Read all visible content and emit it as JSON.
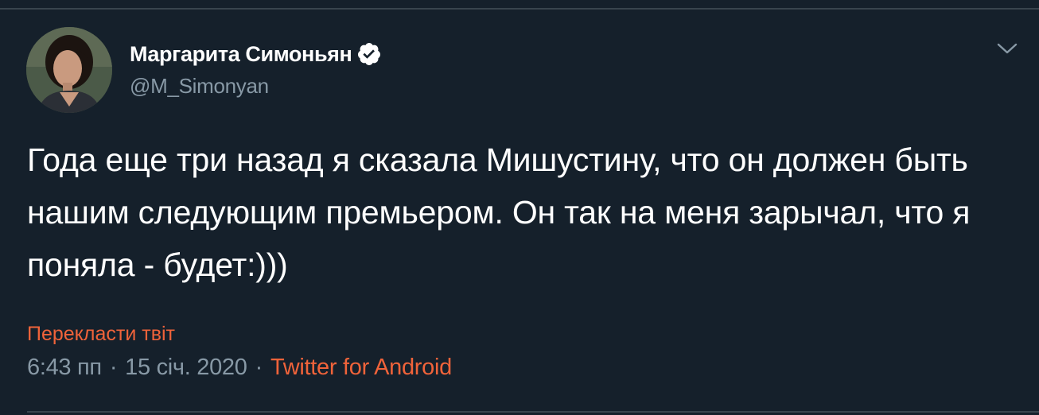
{
  "tweet": {
    "author": {
      "display_name": "Маргарита Симоньян",
      "handle": "@M_Simonyan",
      "verified": true
    },
    "text": "Года еще три назад я сказала Мишустину, что он должен быть нашим следующим премьером. Он так на меня зарычал, что я поняла - будет:)))",
    "translate_label": "Перекласти твіт",
    "time": "6:43 пп",
    "separator": "·",
    "date": "15 січ. 2020",
    "source": "Twitter for Android"
  },
  "icons": {
    "verified": "verified-badge-icon",
    "menu": "chevron-down-icon"
  },
  "colors": {
    "background": "#15202b",
    "text_primary": "#ffffff",
    "text_secondary": "#8899a6",
    "accent_link": "#f0633a",
    "border": "#38444d"
  }
}
